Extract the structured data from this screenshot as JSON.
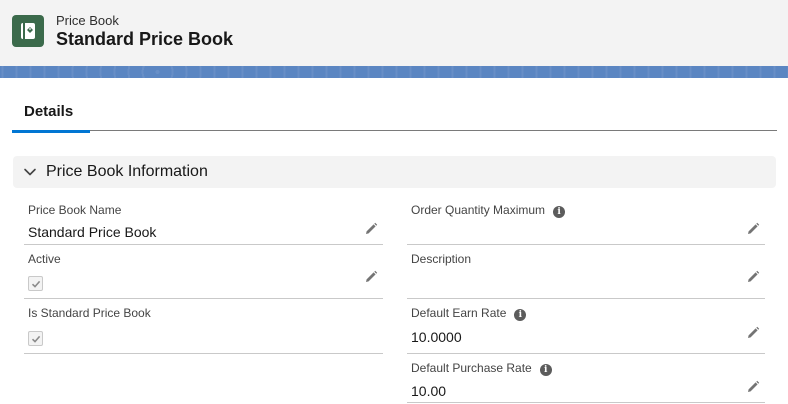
{
  "header": {
    "object_type": "Price Book",
    "title": "Standard Price Book",
    "icon": "pricebook-icon",
    "icon_color": "#3b6a4b"
  },
  "tabs": [
    {
      "label": "Details",
      "active": true
    }
  ],
  "section": {
    "title": "Price Book Information",
    "expanded": true
  },
  "fields": {
    "price_book_name": {
      "label": "Price Book Name",
      "value": "Standard Price Book"
    },
    "active": {
      "label": "Active",
      "checked": true
    },
    "is_standard": {
      "label": "Is Standard Price Book",
      "checked": true
    },
    "order_qty_max": {
      "label": "Order Quantity Maximum",
      "value": ""
    },
    "description": {
      "label": "Description",
      "value": ""
    },
    "default_earn_rate": {
      "label": "Default Earn Rate",
      "value": "10.0000"
    },
    "default_purchase_rate": {
      "label": "Default Purchase Rate",
      "value": "10.00"
    }
  },
  "colors": {
    "accent": "#0176d3",
    "band": "#5b86c2"
  }
}
